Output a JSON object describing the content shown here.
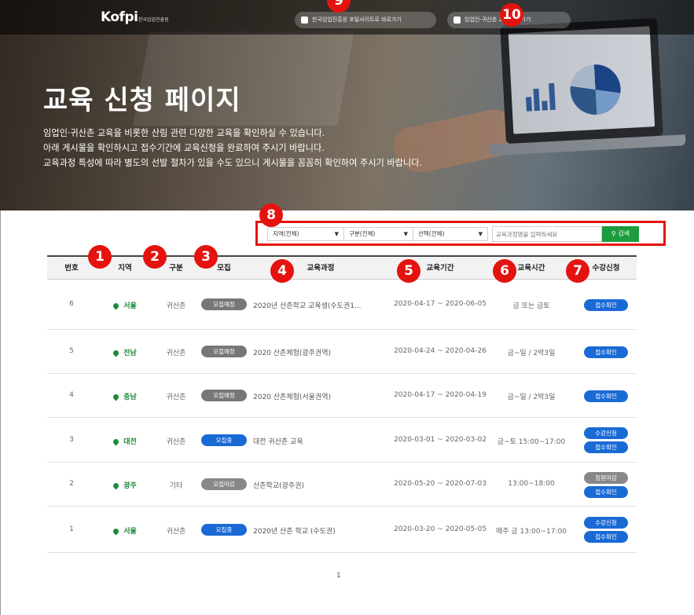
{
  "header": {
    "logo_text": "Kofpi",
    "logo_sub": "한국임업진흥원",
    "link1_label": "한국임업진흥원 포털사이트로 바로가기",
    "link2_label": "임업인-귀산촌 교육 바로가기"
  },
  "hero": {
    "title": "교육 신청 페이지",
    "desc": [
      "임업인·귀산촌 교육을 비롯한 산림 관련 다양한 교육을 확인하실 수 있습니다.",
      "아래 게시물을 확인하시고 접수기간에 교육신청을 완료하여 주시기 바랍니다.",
      "교육과정 특성에 따라 별도의 선발 절차가 있을 수도 있으니 게시물을 꼼꼼히 확인하여 주시기 바랍니다."
    ]
  },
  "annotations": [
    "1",
    "2",
    "3",
    "4",
    "5",
    "6",
    "7",
    "8",
    "9",
    "10"
  ],
  "search": {
    "region": "지역(전체)",
    "category": "구분(전체)",
    "selection": "선택(전체)",
    "placeholder": "교육과정명을 입력하세요",
    "button": "검색"
  },
  "table": {
    "headers": [
      "번호",
      "지역",
      "구분",
      "모집",
      "교육과정",
      "교육기간",
      "교육시간",
      "수강신청"
    ],
    "rows": [
      {
        "no": "6",
        "region": "서울",
        "type": "귀산촌",
        "status": "모집예정",
        "course": "2020년 산촌학교 교육생(수도권1...",
        "period": "2020-04-17 ~ 2020-06-05",
        "time": "금 또는 금토",
        "apply": [
          "접수확인"
        ]
      },
      {
        "no": "5",
        "region": "전남",
        "type": "귀산촌",
        "status": "모집예정",
        "course": "2020 산촌체험(광주권역)",
        "period": "2020-04-24 ~ 2020-04-26",
        "time": "금~일 / 2박3일",
        "apply": [
          "접수확인"
        ]
      },
      {
        "no": "4",
        "region": "충남",
        "type": "귀산촌",
        "status": "모집예정",
        "course": "2020 산촌체험(서울권역)",
        "period": "2020-04-17 ~ 2020-04-19",
        "time": "금~일 / 2박3일",
        "apply": [
          "접수확인"
        ]
      },
      {
        "no": "3",
        "region": "대전",
        "type": "귀산촌",
        "status": "모집중",
        "course": "대전 귀산촌 교육",
        "period": "2020-03-01 ~ 2020-03-02",
        "time": "금~토 15:00~17:00",
        "apply": [
          "수강신청",
          "접수확인"
        ]
      },
      {
        "no": "2",
        "region": "광주",
        "type": "기타",
        "status": "모집마감",
        "course": "산촌학교(광주권)",
        "period": "2020-05-20 ~ 2020-07-03",
        "time": "13:00~18:00",
        "apply": [
          "정원마감",
          "접수확인"
        ]
      },
      {
        "no": "1",
        "region": "서울",
        "type": "귀산촌",
        "status": "모집중",
        "course": "2020년 산촌 학교 (수도권)",
        "period": "2020-03-20 ~ 2020-05-05",
        "time": "매주 금 13:00~17:00",
        "apply": [
          "수강신청",
          "접수확인"
        ]
      }
    ]
  },
  "pagination": {
    "current": "1"
  },
  "colors": {
    "status_planned": "#777777",
    "status_open": "#1a6ad6",
    "status_closed": "#888888",
    "apply_blue": "#1a6ad6",
    "apply_full": "#888888",
    "search_green": "#1c9c3e",
    "annotation_red": "#e4130f"
  }
}
